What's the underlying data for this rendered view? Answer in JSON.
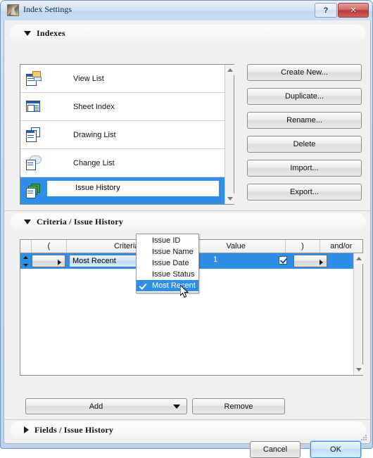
{
  "window": {
    "title": "Index Settings",
    "app_icon": "autocad-app-icon",
    "caption_buttons": [
      {
        "name": "help-button",
        "label": "?"
      },
      {
        "name": "close-button",
        "label": "✕"
      }
    ]
  },
  "sections": {
    "indexes": {
      "title": "Indexes",
      "expanded": true,
      "twisty": "triangle-down-icon"
    },
    "criteria": {
      "title": "Criteria /  Issue History",
      "expanded": true,
      "twisty": "triangle-down-icon"
    },
    "fields": {
      "title": "Fields /  Issue History",
      "expanded": false,
      "twisty": "triangle-right-icon"
    }
  },
  "index_list": {
    "items": [
      {
        "label": "View List",
        "icon": "view-list-icon",
        "selected": false,
        "editing": false
      },
      {
        "label": "Sheet Index",
        "icon": "sheet-index-icon",
        "selected": false,
        "editing": false
      },
      {
        "label": "Drawing List",
        "icon": "drawing-list-icon",
        "selected": false,
        "editing": false
      },
      {
        "label": "Change List",
        "icon": "change-list-icon",
        "selected": false,
        "editing": false
      },
      {
        "label": "Issue History",
        "icon": "issue-history-icon",
        "selected": true,
        "editing": true
      }
    ],
    "scrollbar": {
      "up": "scroll-up-arrow-icon",
      "down": "scroll-down-arrow-icon"
    }
  },
  "side_buttons": [
    {
      "label": "Create New...",
      "name": "create-new-button"
    },
    {
      "label": "Duplicate...",
      "name": "duplicate-button"
    },
    {
      "label": "Rename...",
      "name": "rename-button"
    },
    {
      "label": "Delete",
      "name": "delete-button"
    },
    {
      "label": "Import...",
      "name": "import-button"
    },
    {
      "label": "Export...",
      "name": "export-button"
    }
  ],
  "criteria_grid": {
    "columns": [
      "(",
      "Criteria",
      "Value",
      ")",
      "and/or"
    ],
    "row": {
      "selected": true,
      "open_paren_value": "",
      "criteria_value": "Most Recent",
      "value_text": "1",
      "value_checked": true,
      "close_paren_value": "",
      "andor_value": ""
    },
    "scrollbar": {
      "up": "scroll-up-arrow-icon",
      "down": "scroll-down-arrow-icon"
    }
  },
  "criteria_menu": {
    "open": true,
    "items": [
      {
        "label": "Issue ID",
        "checked": false,
        "highlighted": false
      },
      {
        "label": "Issue Name",
        "checked": false,
        "highlighted": false
      },
      {
        "label": "Issue Date",
        "checked": false,
        "highlighted": false
      },
      {
        "label": "Issue Status",
        "checked": false,
        "highlighted": false
      },
      {
        "label": "Most Recent",
        "checked": true,
        "highlighted": true
      }
    ]
  },
  "bottom_bar": {
    "add_label": "Add",
    "add_dropdown": "chevron-down-icon",
    "remove_label": "Remove"
  },
  "dialog_buttons": {
    "cancel_label": "Cancel",
    "ok_label": "OK",
    "default_button": "ok-button"
  },
  "colors": {
    "selection_blue": "#2f8fe8",
    "title_gradient_top": "#e8f1fb",
    "close_red": "#b93b36",
    "panel_gray": "#f0f0f0",
    "default_button_border": "#3c8dd4"
  }
}
